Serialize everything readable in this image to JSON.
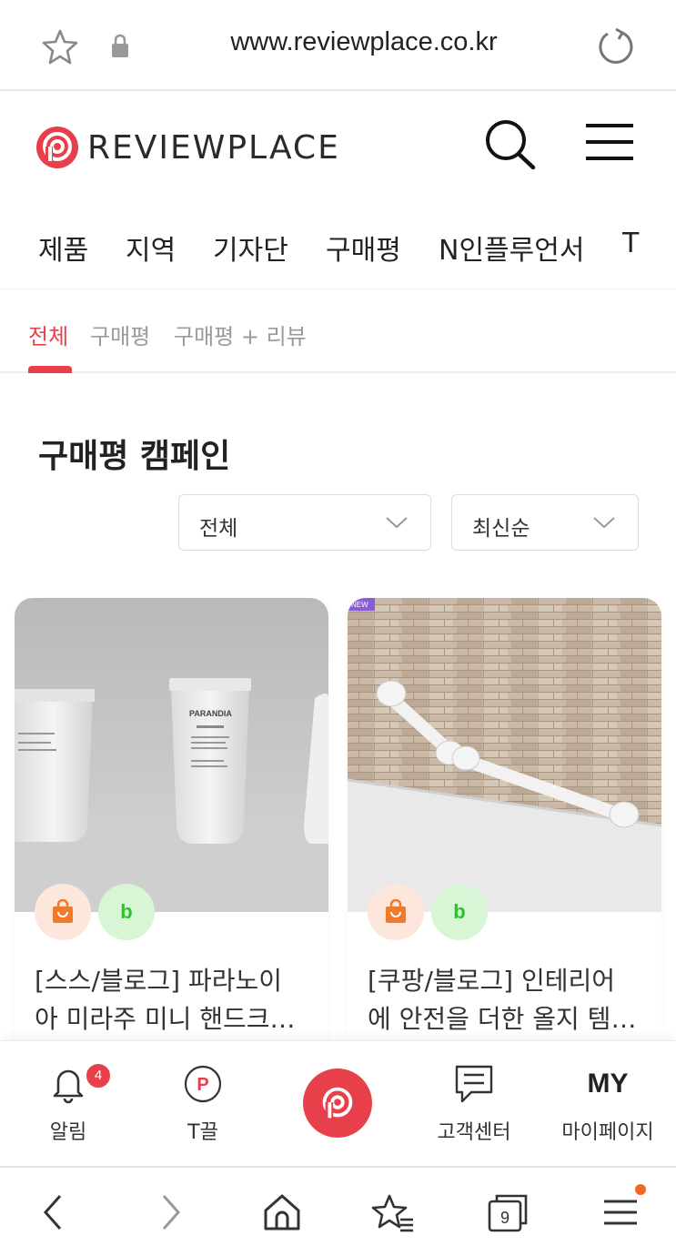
{
  "browser": {
    "url": "www.reviewplace.co.kr",
    "tab_count": "9"
  },
  "header": {
    "logo_text": "REVIEWPLACE",
    "brand_color": "#e8404a"
  },
  "category_nav": {
    "items": [
      "제품",
      "지역",
      "기자단",
      "구매평",
      "N인플루언서",
      "T"
    ]
  },
  "sub_tabs": {
    "items": [
      "전체",
      "구매평",
      "구매평 + 리뷰"
    ],
    "active_index": 0
  },
  "main": {
    "title": "구매평 캠페인",
    "filter_select": "전체",
    "sort_select": "최신순"
  },
  "cards": [
    {
      "title_line1": "[스스/블로그] 파라노이",
      "title_line2": "아 미라주 미니 핸드크…",
      "product_label_text": "PARANDIA"
    },
    {
      "title_line1": "[쿠팡/블로그] 인테리어",
      "title_line2": "에 안전을 더한 올지 템…",
      "corner_tag": "NEW"
    }
  ],
  "badges": {
    "blog_letter": "b"
  },
  "app_nav": {
    "items": [
      {
        "label": "알림",
        "badge": "4"
      },
      {
        "label": "T끌"
      },
      {
        "label": ""
      },
      {
        "label": "고객센터"
      },
      {
        "label": "마이페이지",
        "icon_text": "MY"
      }
    ]
  },
  "icons": {
    "url_star": "star-outline-icon",
    "url_lock": "lock-icon",
    "url_reload": "reload-icon",
    "search": "search-icon",
    "menu": "hamburger-menu-icon",
    "chevron": "chevron-down-icon",
    "bell": "bell-icon",
    "tpoint": "p-circle-icon",
    "chat": "chat-bubble-icon",
    "back": "chevron-left-icon",
    "forward": "chevron-right-icon",
    "home": "home-icon",
    "bookmarks": "star-list-icon",
    "tabs": "tabs-icon",
    "browser_menu": "hamburger-menu-icon"
  }
}
